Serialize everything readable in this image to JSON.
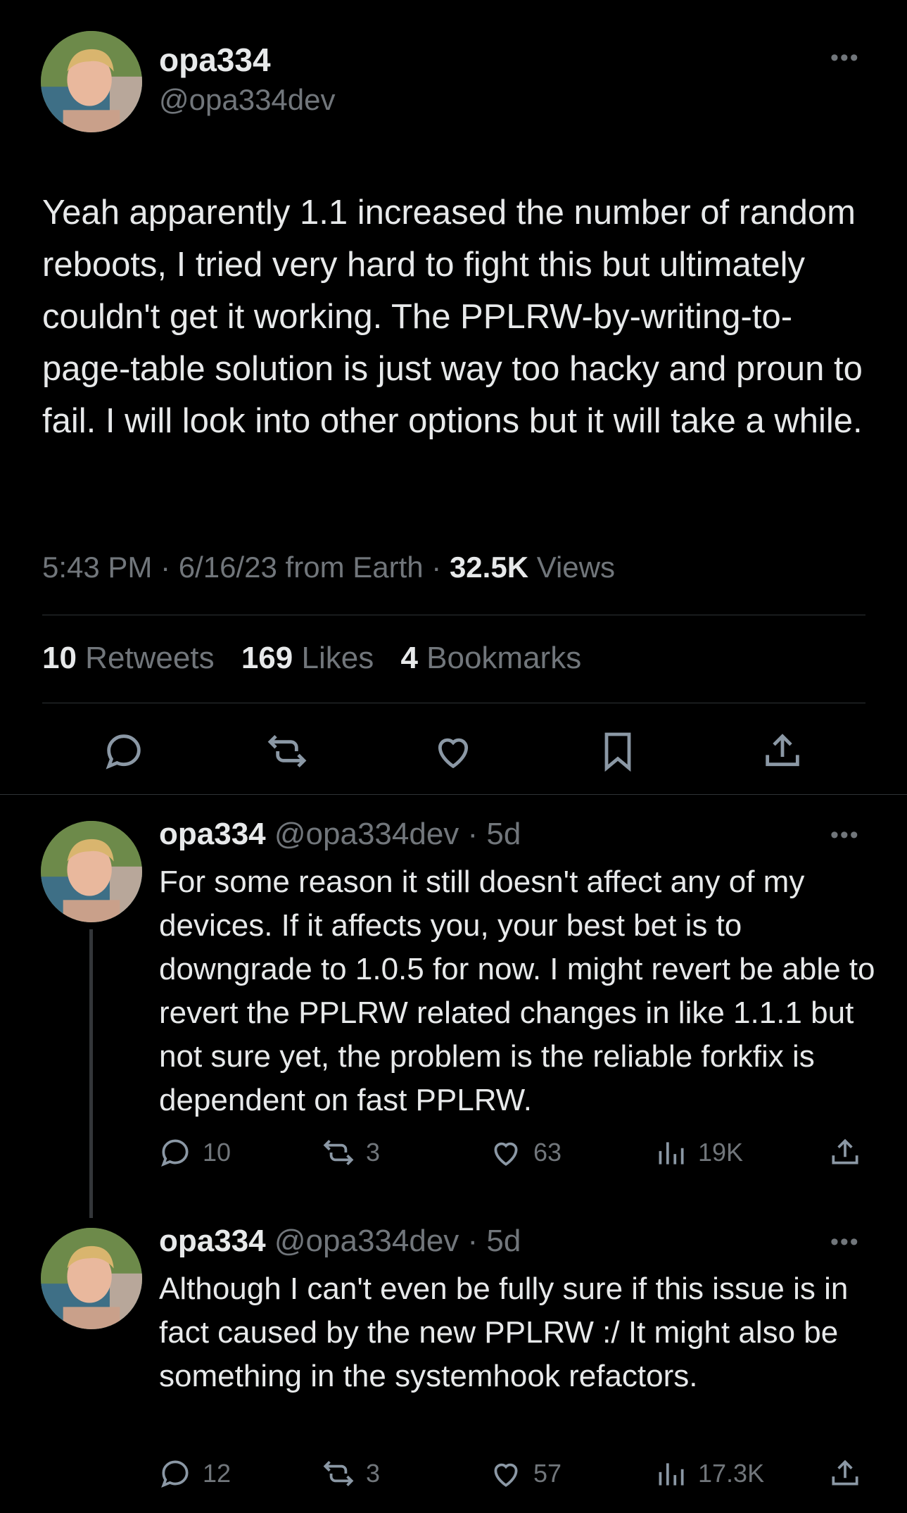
{
  "main_tweet": {
    "display_name": "opa334",
    "handle": "@opa334dev",
    "text": "Yeah apparently 1.1 increased the number of random reboots, I tried very hard to fight this but ultimately couldn't get it working. The PPLRW-by-writing-to-page-table solution is just way too hacky and proun to fail. I will look into other options but it will take a while.",
    "time": "5:43 PM",
    "sep1": " · ",
    "date": "6/16/23",
    "from_text": " from Earth",
    "sep2": " · ",
    "views_count": "32.5K",
    "views_label": " Views",
    "retweets_count": "10",
    "retweets_label": " Retweets",
    "likes_count": "169",
    "likes_label": " Likes",
    "bookmarks_count": "4",
    "bookmarks_label": " Bookmarks",
    "more_icon": "more-horizontal-icon",
    "actions": [
      "reply-icon",
      "retweet-icon",
      "like-icon",
      "bookmark-icon",
      "share-icon"
    ]
  },
  "replies": [
    {
      "display_name": "opa334",
      "handle": "@opa334dev",
      "sep": " · ",
      "age": "5d",
      "text": "For some reason it still doesn't affect any of my devices. If it affects you, your best bet is to downgrade to 1.0.5 for now. I might revert be able to revert the PPLRW related changes in like 1.1.1 but not sure yet, the problem is the reliable forkfix is dependent on fast PPLRW.",
      "reply_count": "10",
      "retweet_count": "3",
      "like_count": "63",
      "view_count": "19K"
    },
    {
      "display_name": "opa334",
      "handle": "@opa334dev",
      "sep": " · ",
      "age": "5d",
      "text": "Although I can't even be fully sure if this issue is in fact caused by the new PPLRW :/ It might also be something in the systemhook refactors.",
      "reply_count": "12",
      "retweet_count": "3",
      "like_count": "57",
      "view_count": "17.3K"
    }
  ],
  "colors": {
    "background": "#000000",
    "text": "#e7e9ea",
    "muted": "#71767b",
    "divider": "#2f3336"
  }
}
